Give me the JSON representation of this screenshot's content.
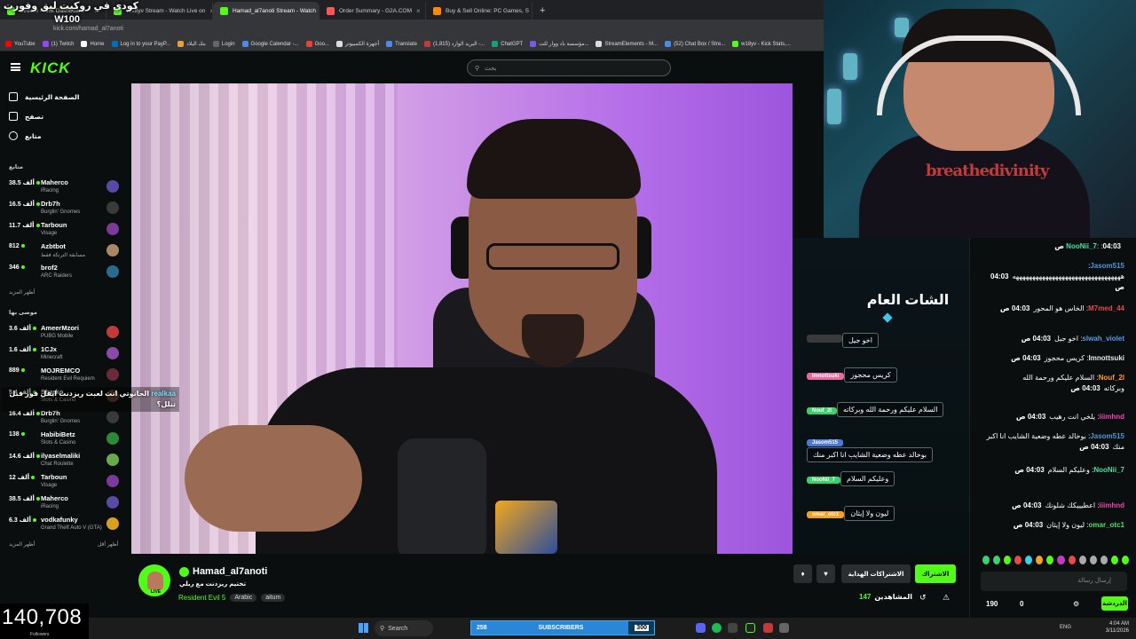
{
  "tabs": [
    {
      "label": "Stream - Kick Dashboard",
      "color": "#53fc18",
      "active": false
    },
    {
      "label": "W18yv Stream - Watch Live on",
      "color": "#53fc18",
      "active": false
    },
    {
      "label": "Hamad_al7anoti Stream - Watch",
      "color": "#53fc18",
      "active": true
    },
    {
      "label": "Order Summary - G2A.COM",
      "color": "#f55",
      "active": false
    },
    {
      "label": "Buy & Sell Online: PC Games, S",
      "color": "#f80",
      "active": false
    }
  ],
  "address": "kick.com/hamad_al7anoti",
  "bookmarks": [
    "YouTube",
    "(1) Twitch",
    "Home",
    "Log in to your PayP...",
    "بنك البلاد",
    "Login",
    "Google Calendar -...",
    "Goo...",
    "أجهزة الكمبيوتر",
    "Translate",
    "(1,815) البريد الوارد -...",
    "ChatGPT",
    "مؤسسة باد ووار للت...",
    "StreamElements - M...",
    "(52) Chat Box / Stre...",
    "w18yv - Kick Stats,..."
  ],
  "overlay_top": [
    "كودي في روكيت ليق وفورت",
    "W100"
  ],
  "search_placeholder": "بحث",
  "sidebar": {
    "nav": [
      "الصفحة الرئيسية",
      "تصفح",
      "متابع"
    ],
    "followed_title": "متابع",
    "followed": [
      {
        "count": "38.5 ألف",
        "name": "Maherco",
        "game": "iRacing",
        "color": "#5a4aa8"
      },
      {
        "count": "16.5 ألف",
        "name": "Drb7h",
        "game": "Burglin' Gnomes",
        "color": "#3a3a3a"
      },
      {
        "count": "11.7 ألف",
        "name": "Tarboun",
        "game": "Visage",
        "color": "#7a3a9a"
      },
      {
        "count": "812",
        "name": "Azbtbot",
        "game": "مسابقة الترنكة فقط",
        "color": "#aa8866"
      },
      {
        "count": "346",
        "name": "brof2",
        "game": "ARC Raiders",
        "color": "#2a6a8a"
      }
    ],
    "show_more": "أظهر المزيد",
    "rec_title": "موصى بها",
    "recommended": [
      {
        "count": "3.6 ألف",
        "name": "AmeerMzori",
        "game": "PUBG Mobile",
        "color": "#c23a3a"
      },
      {
        "count": "1.6 ألف",
        "name": "1CJx",
        "game": "Minecraft",
        "color": "#8a4aaa"
      },
      {
        "count": "889",
        "name": "MOJREMCO",
        "game": "Resident Evil Requiem",
        "color": "#6a2a3a"
      },
      {
        "count": "5.4 ألف",
        "name": "Sharko",
        "game": "Slots & Casino",
        "color": "#5a3a2a"
      },
      {
        "count": "16.4 ألف",
        "name": "Drb7h",
        "game": "Burglin' Gnomes",
        "color": "#3a3a3a"
      },
      {
        "count": "138",
        "name": "HabibiBetz",
        "game": "Slots & Casino",
        "color": "#2a8a3a"
      },
      {
        "count": "14.6 ألف",
        "name": "ilyaselmaliki",
        "game": "Chat Roulette",
        "color": "#6aaa4a"
      },
      {
        "count": "12 ألف",
        "name": "Tarboun",
        "game": "Visage",
        "color": "#7a3a9a"
      },
      {
        "count": "38.5 ألف",
        "name": "Maherco",
        "game": "iRacing",
        "color": "#5a4aa8"
      },
      {
        "count": "6.3 ألف",
        "name": "vodkafunky",
        "game": "Grand Theft Auto V (GTA)",
        "color": "#d9a020"
      }
    ],
    "show_more2": "أظهر المزيد",
    "show_less": "أظهر أقل"
  },
  "left_overlay_chat": {
    "user": "realkaa",
    "text": "الحانوتي انت لعبت ريزدنت ايفل فور قبل تتلل؟"
  },
  "mid_chat": {
    "title": "الشات العام",
    "messages": [
      {
        "user": "",
        "text": "اخو جيل",
        "tag_color": "#3a3a3a"
      },
      {
        "user": "Imnottsuki",
        "text": "كريس محجوز",
        "tag_color": "#e86aa0"
      },
      {
        "user": "Nouf_2l",
        "text": "السلام عليكم ورحمة الله وبركاته",
        "tag_color": "#3bd16f"
      },
      {
        "user": "Jasom515",
        "text": "بوخالد عطه وضعية الشايب انا اكبر منك",
        "tag_color": "#4a7ad9"
      },
      {
        "user": "NooNii_7",
        "text": "وعليكم السلام",
        "tag_color": "#3bd16f"
      },
      {
        "user": "omar_otc1",
        "text": "ليون ولا إيثان",
        "tag_color": "#f2a12a"
      }
    ]
  },
  "chat": {
    "messages": [
      {
        "time": "04:03 ص",
        "user": "NooNii_7",
        "color": "#4ae0a0",
        "text": ":"
      },
      {
        "time": "04:03 ص",
        "user": "Jasom515",
        "color": "#4a9ad9",
        "text": "هههههههههههههههههههههههههههههههههه"
      },
      {
        "time": "04:03 ص",
        "user": "M7med_44",
        "color": "#e84a4a",
        "text": "الخاس هو المحور"
      },
      {
        "time": "04:03 ص",
        "user": "slwah_violet",
        "color": "#5a9ae8",
        "text": "اخو جيل"
      },
      {
        "time": "04:03 ص",
        "user": "Imnottsuki",
        "color": "#e8e8e8",
        "text": "كريس محجوز"
      },
      {
        "time": "04:03 ص",
        "user": "Nouf_2l",
        "color": "#ff9a3a",
        "text": "السلام عليكم ورحمة الله وبركاته"
      },
      {
        "time": "04:03 ص",
        "user": "iiimhnd",
        "color": "#e84ab0",
        "text": "يلخي انت رهيب"
      },
      {
        "time": "04:03 ص",
        "user": "Jasom515",
        "color": "#4a9ad9",
        "text": "بوخالد عطه وضعية الشايب انا اكبر منك"
      },
      {
        "time": "04:03 ص",
        "user": "NooNii_7",
        "color": "#4ae0a0",
        "text": "وعليكم السلام"
      },
      {
        "time": "04:03 ص",
        "user": "iiimhnd",
        "color": "#e84ab0",
        "text": "اعطيييكك شلونك"
      },
      {
        "time": "04:03 ص",
        "user": "omar_otc1",
        "color": "#4ae06a",
        "text": "ليون ولا إيثان"
      }
    ],
    "input_placeholder": "إرسال رسالة",
    "points": "190",
    "zero": "0",
    "send_label": "الدردشة"
  },
  "streamer": {
    "name": "Hamad_al7anoti",
    "title": "تختيم ريزدنت مع ربلي",
    "game": "Resident Evil 5",
    "tags": [
      "Arabic",
      "aitum"
    ],
    "live": "LIVE",
    "follow_label": "الاشتراك",
    "gift_label": "الاشتراكات الهداية",
    "viewers": "147",
    "viewers_label": "المشاهدين"
  },
  "followers": {
    "count": "140,708",
    "label": "Followers"
  },
  "taskbar": {
    "search": "Search",
    "subs_left": "258",
    "subs_label": "SUBSCRIBERS",
    "subs_right": "300",
    "subs_progress": 0.86,
    "lang": "ENG",
    "time": "4:04 AM",
    "date": "3/11/2026"
  }
}
